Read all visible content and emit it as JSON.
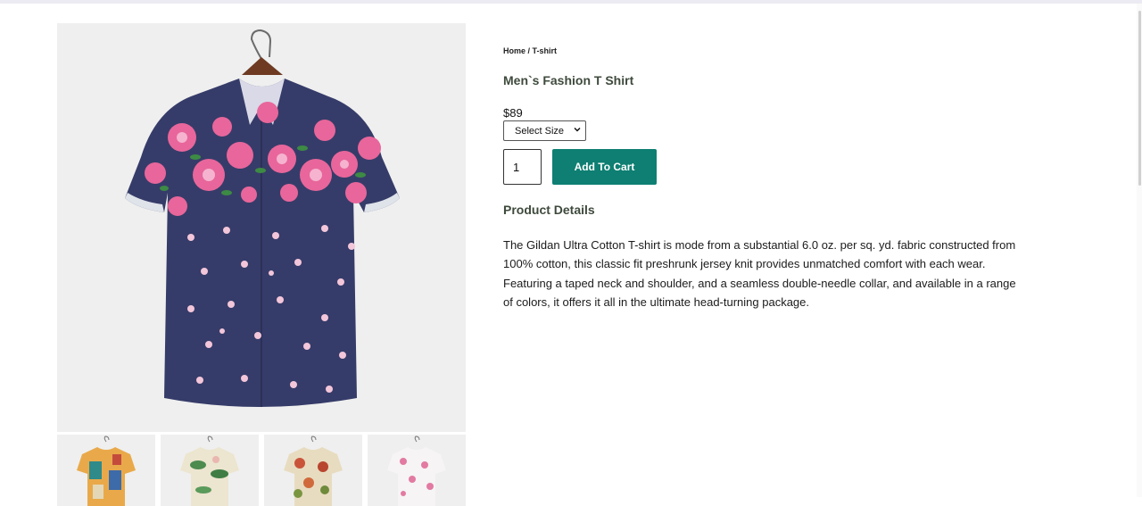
{
  "breadcrumb": {
    "home": "Home",
    "separator": " / ",
    "current": "T-shirt"
  },
  "product": {
    "title": "Men`s Fashion T Shirt",
    "price": "$89",
    "size_select": {
      "selected": "Select Size"
    },
    "quantity": "1",
    "add_to_cart_label": "Add To Cart",
    "details_heading": "Product Details",
    "description": "The Gildan Ultra Cotton T-shirt is mode from a substantial 6.0 oz. per sq. yd. fabric constructed from 100% cotton, this classic fit preshrunk jersey knit provides unmatched comfort with each wear. Featuring a taped neck and shoulder, and a seamless double-needle collar, and available in a range of colors, it offers it all in the ultimate head-turning package."
  },
  "colors": {
    "accent": "#0e7f72",
    "heading": "#3e4a3c",
    "shirt_navy": "#363c69",
    "flower_pink": "#e8669b"
  },
  "icons": {
    "select_caret": "chevron-down-icon"
  }
}
